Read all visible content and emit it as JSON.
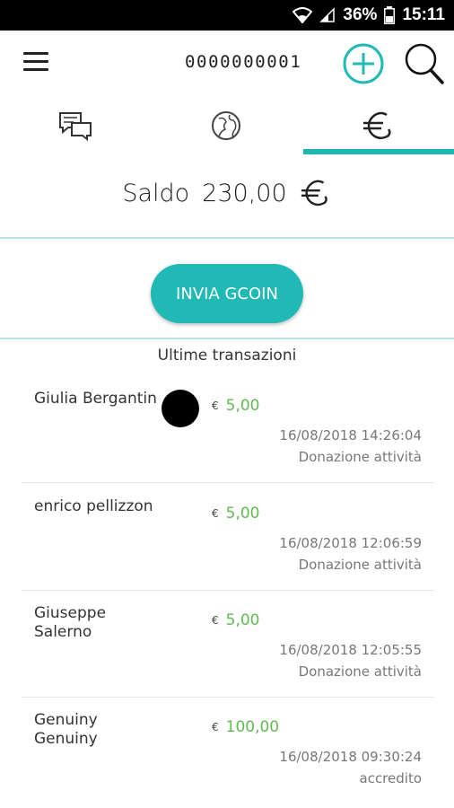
{
  "statusbar": {
    "battery": "36%",
    "time": "15:11"
  },
  "header": {
    "account_id": "0000000001",
    "add_icon": "plus-circle-icon",
    "search_icon": "search-icon",
    "menu_icon": "hamburger-menu-icon"
  },
  "tabs": [
    {
      "icon": "chat-bubbles-icon",
      "active": false
    },
    {
      "icon": "globe-head-icon",
      "active": false
    },
    {
      "icon": "coin-icon",
      "active": true
    }
  ],
  "balance": {
    "label": "Saldo",
    "value": "230,00"
  },
  "actions": {
    "send_label": "INVIA GCOIN"
  },
  "transactions_title": "Ultime transazioni",
  "transactions": [
    {
      "name": "Giulia Bergantin",
      "has_avatar": true,
      "amount": "5,00",
      "date": "16/08/2018 14:26:04",
      "description": "Donazione attività"
    },
    {
      "name": "enrico pellizzon",
      "has_avatar": false,
      "amount": "5,00",
      "date": "16/08/2018 12:06:59",
      "description": "Donazione attività"
    },
    {
      "name": "Giuseppe Salerno",
      "has_avatar": false,
      "amount": "5,00",
      "date": "16/08/2018 12:05:55",
      "description": "Donazione attività"
    },
    {
      "name": "Genuiny Genuiny",
      "has_avatar": false,
      "amount": "100,00",
      "date": "16/08/2018 09:30:24",
      "description": "accredito"
    }
  ],
  "colors": {
    "accent": "#20b9b5",
    "amount": "#5fbb52"
  }
}
